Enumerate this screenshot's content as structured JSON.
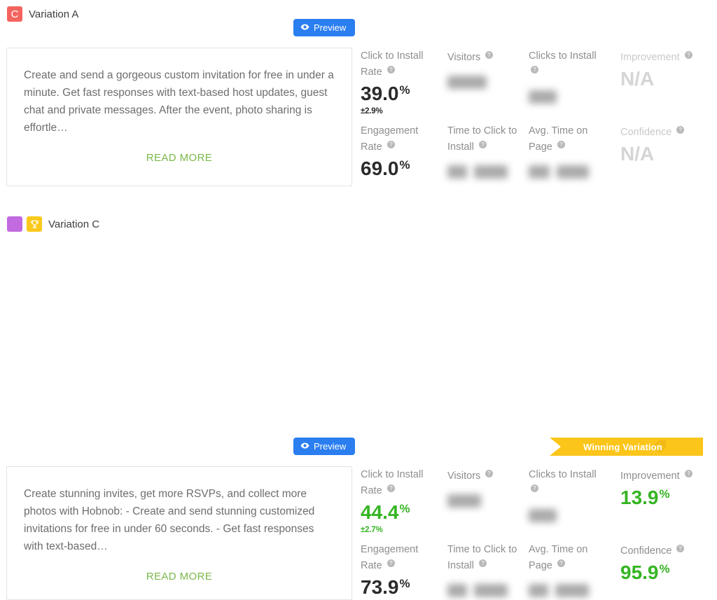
{
  "variations": [
    {
      "id": "variation-a",
      "swatch": {
        "color": "#f4645f",
        "letter": "C",
        "name": "color-swatch-red"
      },
      "winner": false,
      "title": "Variation A",
      "preview": {
        "label": "Preview",
        "color": "#2a7ef0",
        "icon": "eye-icon"
      },
      "card": {
        "body": "Create and send a gorgeous custom invitation for free in under a minute. Get fast responses with text-based host updates, guest chat and private messages. After the event, photo sharing is effortle…",
        "read_more": "READ MORE"
      },
      "metrics_row1": [
        {
          "label": "Click to Install Rate",
          "help": true,
          "value": "39.0",
          "unit": "%",
          "margin": "±2.9%",
          "style": "normal"
        },
        {
          "label": "Visitors",
          "help": true,
          "value": "",
          "unit": "",
          "style": "blurred",
          "blur_widths": [
            56
          ]
        },
        {
          "label": "Clicks to Install",
          "help": true,
          "value": "",
          "unit": "",
          "style": "blurred",
          "blur_widths": [
            40
          ]
        },
        {
          "label": "Improvement",
          "help": true,
          "value": "N/A",
          "unit": "",
          "style": "na"
        }
      ],
      "metrics_row2": [
        {
          "label": "Engagement Rate",
          "help": true,
          "value": "69.0",
          "unit": "%",
          "style": "normal"
        },
        {
          "label": "Time to Click to Install",
          "help": true,
          "value": "",
          "unit": "",
          "style": "blurred",
          "blur_widths": [
            28,
            48
          ]
        },
        {
          "label": "Avg. Time on Page",
          "help": true,
          "value": "",
          "unit": "",
          "style": "blurred",
          "blur_widths": [
            30,
            46
          ]
        },
        {
          "label": "Confidence",
          "help": true,
          "value": "N/A",
          "unit": "",
          "style": "na"
        }
      ]
    },
    {
      "id": "variation-c",
      "swatch": {
        "color": "#c26ae0",
        "letter": "",
        "name": "color-swatch-purple"
      },
      "winner": true,
      "trophy": {
        "color": "#fbc91b",
        "name": "trophy-icon"
      },
      "title": "Variation C",
      "preview": {
        "label": "Preview",
        "color": "#2a7ef0",
        "icon": "eye-icon"
      },
      "ribbon": {
        "label": "Winning Variation",
        "color": "#fbc51a",
        "watermark": "tag-icon"
      },
      "card": {
        "body": "Create stunning invites, get more RSVPs, and collect more photos with Hobnob: - Create and send stunning customized invitations for free in under 60 seconds. - Get fast responses with text-based…",
        "read_more": "READ MORE"
      },
      "metrics_row1": [
        {
          "label": "Click to Install Rate",
          "help": true,
          "value": "44.4",
          "unit": "%",
          "margin": "±2.7%",
          "style": "green"
        },
        {
          "label": "Visitors",
          "help": true,
          "value": "",
          "unit": "",
          "style": "blurred",
          "blur_widths": [
            48
          ]
        },
        {
          "label": "Clicks to Install",
          "help": true,
          "value": "",
          "unit": "",
          "style": "blurred",
          "blur_widths": [
            40
          ]
        },
        {
          "label": "Improvement",
          "help": true,
          "value": "13.9",
          "unit": "%",
          "style": "green"
        }
      ],
      "metrics_row2": [
        {
          "label": "Engagement Rate",
          "help": true,
          "value": "73.9",
          "unit": "%",
          "style": "normal"
        },
        {
          "label": "Time to Click to Install",
          "help": true,
          "value": "",
          "unit": "",
          "style": "blurred",
          "blur_widths": [
            28,
            48
          ]
        },
        {
          "label": "Avg. Time on Page",
          "help": true,
          "value": "",
          "unit": "",
          "style": "blurred",
          "blur_widths": [
            28,
            48
          ]
        },
        {
          "label": "Confidence",
          "help": true,
          "value": "95.9",
          "unit": "%",
          "style": "green"
        }
      ]
    }
  ],
  "colors": {
    "accent_blue": "#2a7ef0",
    "green": "#36b524",
    "read_more_green": "#7ab84b",
    "ribbon_yellow": "#fbc51a",
    "na_gray": "#d5d5d5"
  }
}
